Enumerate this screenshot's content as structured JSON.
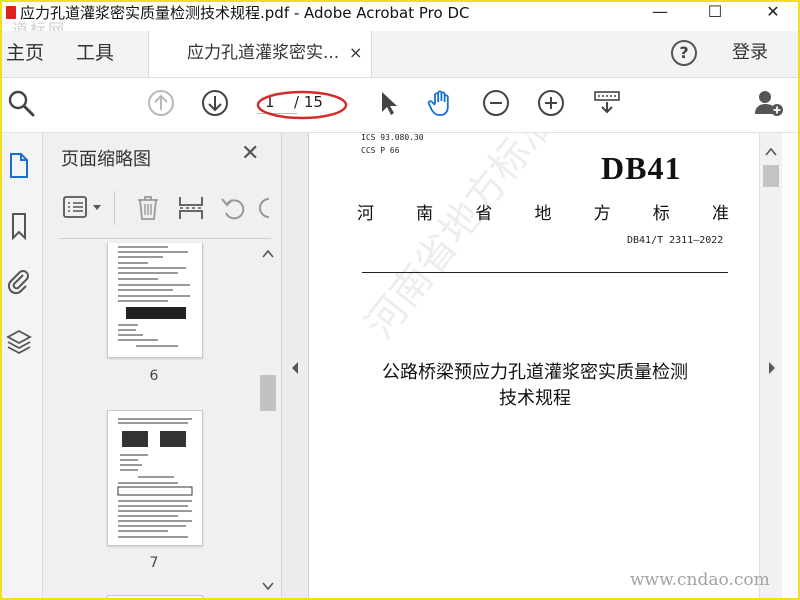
{
  "window": {
    "title": "应力孔道灌浆密实质量检测技术规程.pdf - Adobe Acrobat Pro DC",
    "minimize": "—",
    "maximize": "☐",
    "close": "✕"
  },
  "menubar": {
    "home": "主页",
    "tools": "工具",
    "doc_tab": "应力孔道灌浆密实...",
    "doc_tab_close": "×",
    "help": "?",
    "login": "登录"
  },
  "toolbar": {
    "current_page": "1",
    "page_total": "/ 15"
  },
  "panel": {
    "title": "页面缩略图",
    "close": "✕",
    "thumbnails": [
      {
        "label": "6"
      },
      {
        "label": "7"
      }
    ]
  },
  "document": {
    "ics": "ICS  93.080.30",
    "ccs": "CCS P 66",
    "logo": "DB41",
    "province_chars": [
      "河",
      "南",
      "省",
      "地",
      "方",
      "标",
      "准"
    ],
    "standard_number": "DB41/T 2311—2022",
    "title_line1": "公路桥梁预应力孔道灌浆密实质量检测",
    "title_line2": "技术规程",
    "watermark": "河南省地方标准公共服务平台"
  },
  "overlays": {
    "corner_watermark": "道标网",
    "site_watermark": "www.cndao.com"
  },
  "colors": {
    "accent_blue": "#1a6fd3",
    "annotation_red": "#d42a2a",
    "frame_yellow": "#f2df1a"
  }
}
